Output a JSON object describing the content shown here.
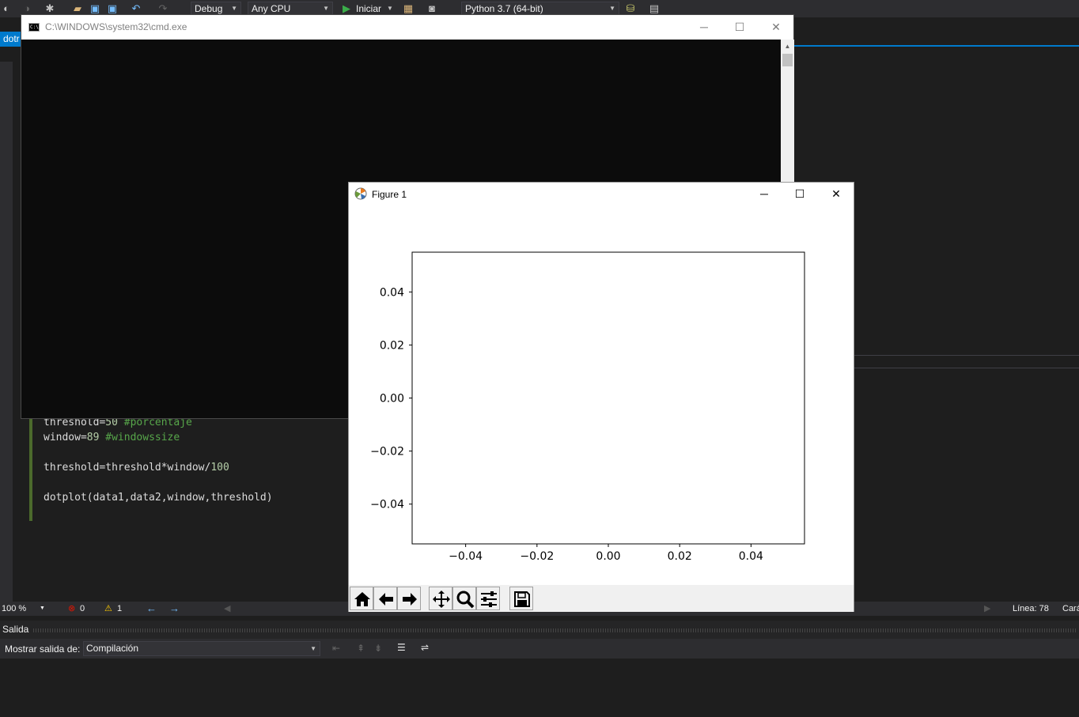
{
  "vs_toolbar": {
    "config_combo": "Debug",
    "platform_combo": "Any CPU",
    "start_label": "Iniciar",
    "environment_combo": "Python 3.7 (64-bit)"
  },
  "document_tab": {
    "label": "dotr"
  },
  "editor": {
    "lines": [
      {
        "code": "threshold=",
        "num": "50",
        "comment": " #porcentaje"
      },
      {
        "code": "window=",
        "num": "89",
        "comment": " #windowssize"
      },
      {
        "code": "",
        "num": "",
        "comment": ""
      },
      {
        "code": "threshold=threshold*window/",
        "num": "100",
        "comment": ""
      },
      {
        "code": "",
        "num": "",
        "comment": ""
      },
      {
        "code": "dotplot(data1,data2,window,threshold)",
        "num": "",
        "comment": ""
      }
    ]
  },
  "status_bar": {
    "zoom": "100 %",
    "errors": "0",
    "warnings": "1",
    "line": "Línea: 78",
    "col_trunc": "Cará"
  },
  "output_panel": {
    "title": "Salida",
    "source_label": "Mostrar salida de:",
    "source_value": "Compilación"
  },
  "cmd_window": {
    "title": "C:\\WINDOWS\\system32\\cmd.exe"
  },
  "figure_window": {
    "title": "Figure 1",
    "toolbar": [
      "home-icon",
      "back-arrow-icon",
      "forward-arrow-icon",
      "pan-icon",
      "zoom-icon",
      "configure-subplots-icon",
      "save-icon"
    ]
  },
  "chart_data": {
    "type": "scatter",
    "title": "",
    "xlabel": "",
    "ylabel": "",
    "xlim": [
      -0.055,
      0.055
    ],
    "ylim": [
      -0.055,
      0.055
    ],
    "xticks": [
      "−0.04",
      "−0.02",
      "0.00",
      "0.02",
      "0.04"
    ],
    "xtick_values": [
      -0.04,
      -0.02,
      0.0,
      0.02,
      0.04
    ],
    "yticks": [
      "0.04",
      "0.02",
      "0.00",
      "−0.02",
      "−0.04"
    ],
    "ytick_values": [
      0.04,
      0.02,
      0.0,
      -0.02,
      -0.04
    ],
    "x": [],
    "y": [],
    "grid": false
  }
}
